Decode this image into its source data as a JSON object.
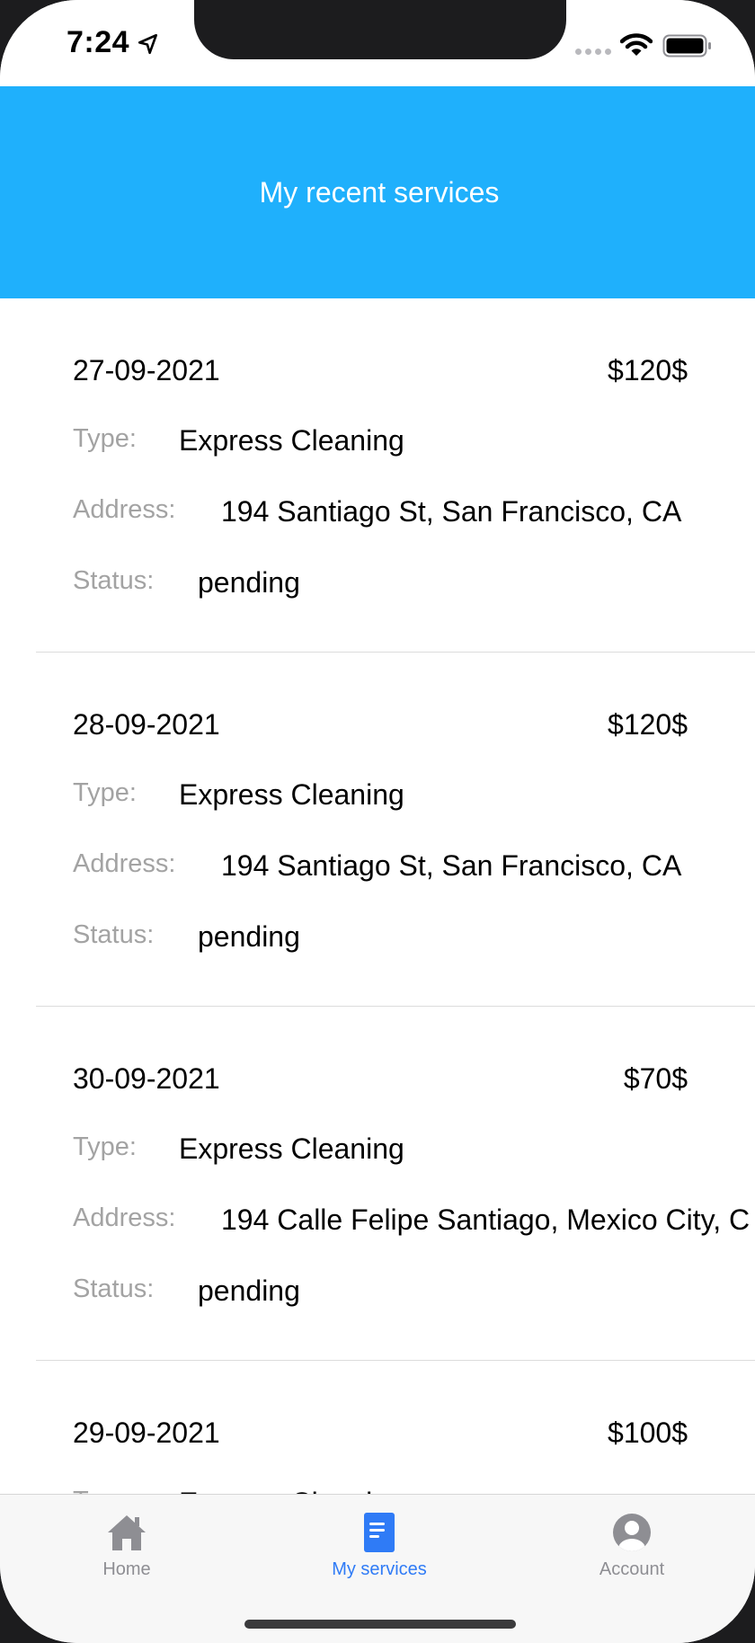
{
  "status_bar": {
    "time": "7:24",
    "location_icon": "location-arrow-icon",
    "signal_icon": "cellular-signal-icon",
    "wifi_icon": "wifi-icon",
    "battery_icon": "battery-icon"
  },
  "header": {
    "title": "My recent services",
    "background_color": "#1fb0fc"
  },
  "labels": {
    "type": "Type:",
    "address": "Address:",
    "status": "Status:"
  },
  "services": [
    {
      "date": "27-09-2021",
      "price": "$120$",
      "type": "Express Cleaning",
      "address": "194 Santiago St, San Francisco, CA",
      "status": "pending"
    },
    {
      "date": "28-09-2021",
      "price": "$120$",
      "type": "Express Cleaning",
      "address": "194 Santiago St, San Francisco, CA",
      "status": "pending"
    },
    {
      "date": "30-09-2021",
      "price": "$70$",
      "type": "Express Cleaning",
      "address": "194 Calle Felipe Santiago, Mexico City, C",
      "status": "pending"
    },
    {
      "date": "29-09-2021",
      "price": "$100$",
      "type": "Express Cleaning",
      "address": "",
      "status": ""
    }
  ],
  "tab_bar": {
    "active_color": "#2f7bf6",
    "inactive_color": "#8e8e93",
    "tabs": [
      {
        "label": "Home",
        "icon": "home-icon"
      },
      {
        "label": "My services",
        "icon": "document-icon"
      },
      {
        "label": "Account",
        "icon": "user-avatar-icon"
      }
    ]
  }
}
